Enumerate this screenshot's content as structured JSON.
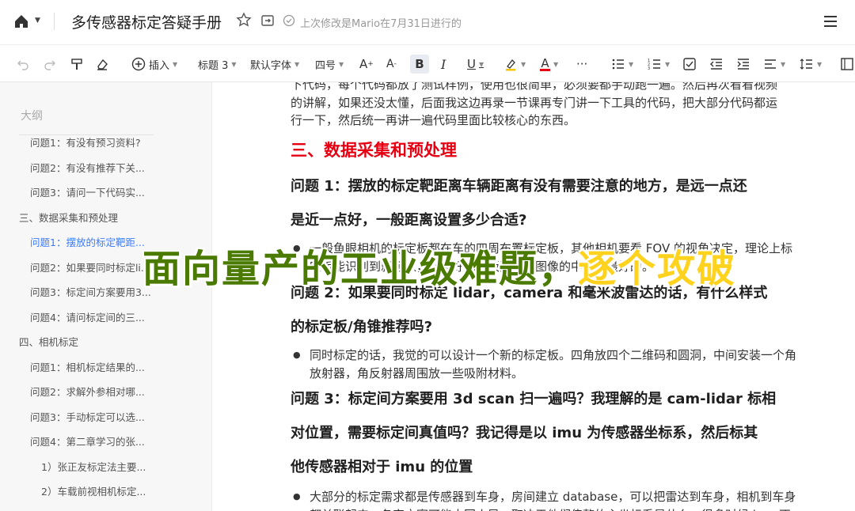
{
  "header": {
    "title": "多传感器标定答疑手册",
    "saved_text": "上次修改是Mario在7月31日进行的",
    "icons": [
      "home-icon",
      "star-icon",
      "move-to-icon",
      "check-circle-icon",
      "hamburger-menu-icon"
    ]
  },
  "toolbar": {
    "insert_label": "插入",
    "heading_label": "标题 3",
    "font_label": "默认字体",
    "size_label": "四号",
    "bold_label": "B",
    "italic_label": "I",
    "underline_label": "U",
    "font_color_label": "A",
    "more_label": "···",
    "accent_color": "#e60012",
    "highlight_color": "#f5c400"
  },
  "sidebar": {
    "title": "大纲",
    "items": [
      {
        "label": "问题1：有没有预习资料?"
      },
      {
        "label": "问题2：有没有推荐下关..."
      },
      {
        "label": "问题3：请问一下代码实..."
      },
      {
        "label": "三、数据采集和预处理"
      },
      {
        "label": "问题1：摆放的标定靶距..."
      },
      {
        "label": "问题2：如果要同时标定li..."
      },
      {
        "label": "问题3：标定间方案要用3..."
      },
      {
        "label": "问题4：请问标定间的三..."
      },
      {
        "label": "四、相机标定"
      },
      {
        "label": "问题1：相机标定结果的..."
      },
      {
        "label": "问题2：求解外参相对哪..."
      },
      {
        "label": "问题3：手动标定可以选..."
      },
      {
        "label": "问题4：第二章学习的张..."
      },
      {
        "label": "1）张正友标定法主要..."
      },
      {
        "label": "2）车载前视相机标定..."
      }
    ]
  },
  "content": {
    "top_para_line0": "下代码，每个代码都放了测试样例，使用也很简单，必须要都手动跑一遍。然后再次看看视频",
    "top_para_line1": "的讲解，如果还没太懂，后面我这边再录一节课再专门讲一下工具的代码，把大部分代码都运",
    "top_para_line2": "行一下，然后统一再讲一遍代码里面比较核心的东西。",
    "section3_title": "三、数据采集和预处理",
    "q1_line1": "问题 1：摆放的标定靶距离车辆距离有没有需要注意的地方，是远一点还",
    "q1_line2": "是近一点好，一般距离设置多少合适?",
    "q1_answer": "一般鱼眼相机的标定板都在车的四周布置标定板，其他相机要看 FOV 的视角决定，理论上标定板能识别到就可以，但最好标定板要处于图像的中心是最好的。",
    "q2_line1": "问题 2：如果要同时标定 lidar，camera 和毫米波雷达的话，有什么样式",
    "q2_line2": "的标定板/角锥推荐吗?",
    "q2_answer": "同时标定的话，我觉的可以设计一个新的标定板。四角放四个二维码和圆洞，中间安装一个角放射器，角反射器周围放一些吸附材料。",
    "q3_line1": "问题 3：标定间方案要用 3d scan 扫一遍吗？我理解的是 cam-lidar 标相",
    "q3_line2": "对位置，需要标定间真值吗？我记得是以 imu 为传感器坐标系，然后标其",
    "q3_line3": "他传感器相对于 imu 的位置",
    "q3_answer": "大部分的标定需求都是传感器到车身，房间建立 database，可以把雷达到车身，相机到车身都关联起来，各家方案可能大同小异，取决于他们传整的主坐标系是什么，很多时候 imu 不"
  },
  "overlay": {
    "text_main": "面向量产的工业级难题，",
    "text_accent": "逐个攻破"
  }
}
